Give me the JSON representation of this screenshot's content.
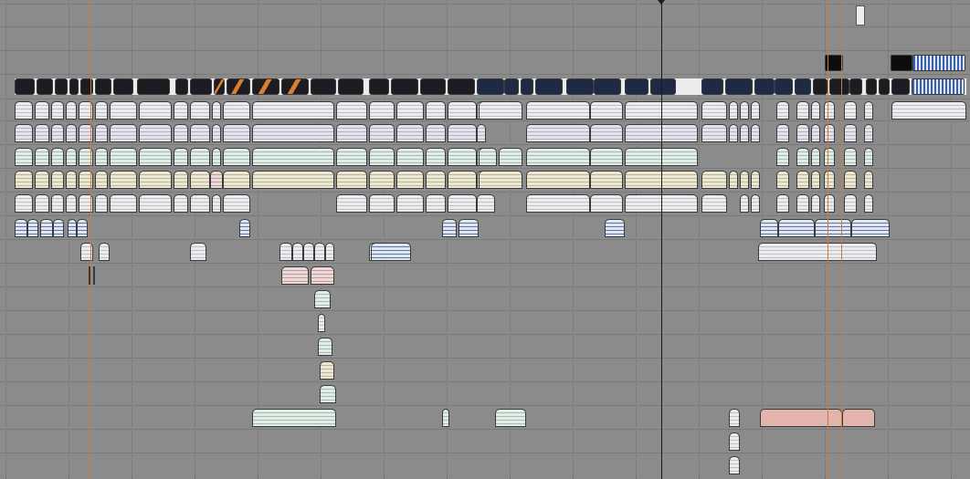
{
  "window": {
    "title": ""
  },
  "timeline": {
    "grid_count": 16,
    "track_count": 20
  },
  "colors": {
    "background": "#8b8b8b",
    "marker": "#d07a3a",
    "playhead": "#1a1a1a",
    "clip_blue": "#5d78a8",
    "clip_salmon": "#e2b4ac"
  }
}
